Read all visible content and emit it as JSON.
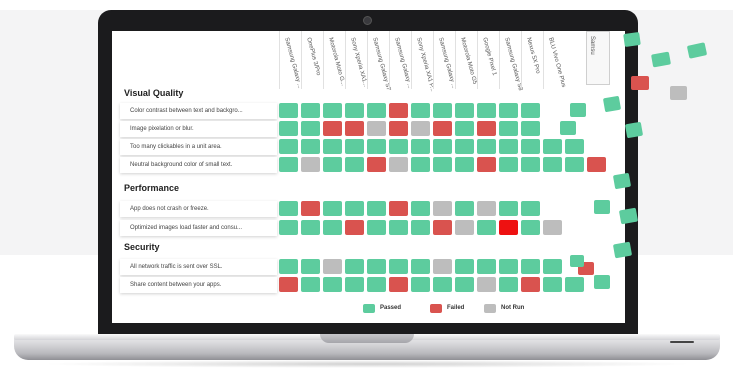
{
  "colors": {
    "passed": "#5dcc9e",
    "failed": "#d9534f",
    "not_run": "#bdbdbd",
    "failed_strong": "#ee1111"
  },
  "devices": [
    "Samsung Galaxy ...",
    "OnePlus 3/Pro",
    "Motorola Moto G...",
    "Sony Xperia XA1...",
    "Samsung Galaxy S7",
    "Samsung Galaxy ...",
    "Sony Xperia XA1 P...",
    "Samsung Galaxy ...",
    "Motorola Moto G5",
    "Google Pixel 1",
    "Samsung Galaxy S8",
    "Nexus 5X Pro",
    "BLU Vivo One Plus"
  ],
  "header_tab_label": "Samsu",
  "sections": [
    {
      "title": "Visual Quality",
      "tests": [
        {
          "label": "Color contrast between text and backgro...",
          "results": [
            "P",
            "P",
            "P",
            "P",
            "P",
            "F",
            "P",
            "P",
            "P",
            "P",
            "P",
            "P"
          ]
        },
        {
          "label": "Image pixelation or blur.",
          "results": [
            "P",
            "P",
            "F",
            "F",
            "N",
            "F",
            "N",
            "F",
            "P",
            "F",
            "P",
            "P"
          ]
        },
        {
          "label": "Too many clickables in a unit area.",
          "results": [
            "P",
            "P",
            "P",
            "P",
            "P",
            "P",
            "P",
            "P",
            "P",
            "P",
            "P",
            "P",
            "P",
            "P"
          ]
        },
        {
          "label": "Neutral background color of small text.",
          "results": [
            "P",
            "N",
            "P",
            "P",
            "F",
            "N",
            "P",
            "P",
            "P",
            "F",
            "P",
            "P",
            "P",
            "P",
            "F"
          ]
        }
      ]
    },
    {
      "title": "Performance",
      "tests": [
        {
          "label": "App does not crash or freeze.",
          "results": [
            "P",
            "F",
            "P",
            "P",
            "P",
            "F",
            "P",
            "N",
            "P",
            "N",
            "P",
            "P"
          ]
        },
        {
          "label": "Optimized images load faster and consu...",
          "results": [
            "P",
            "P",
            "P",
            "F",
            "P",
            "P",
            "P",
            "F",
            "N",
            "P",
            "X",
            "P",
            "N"
          ]
        }
      ]
    },
    {
      "title": "Security",
      "tests": [
        {
          "label": "All network traffic is sent over SSL.",
          "results": [
            "P",
            "P",
            "N",
            "P",
            "P",
            "P",
            "P",
            "N",
            "P",
            "P",
            "P",
            "P",
            "P"
          ]
        },
        {
          "label": "Share content between your apps.",
          "results": [
            "F",
            "P",
            "P",
            "P",
            "P",
            "F",
            "P",
            "P",
            "P",
            "N",
            "P",
            "F",
            "P",
            "P"
          ]
        }
      ]
    }
  ],
  "legend": {
    "passed": "Passed",
    "failed": "Failed",
    "not_run": "Not Run"
  }
}
